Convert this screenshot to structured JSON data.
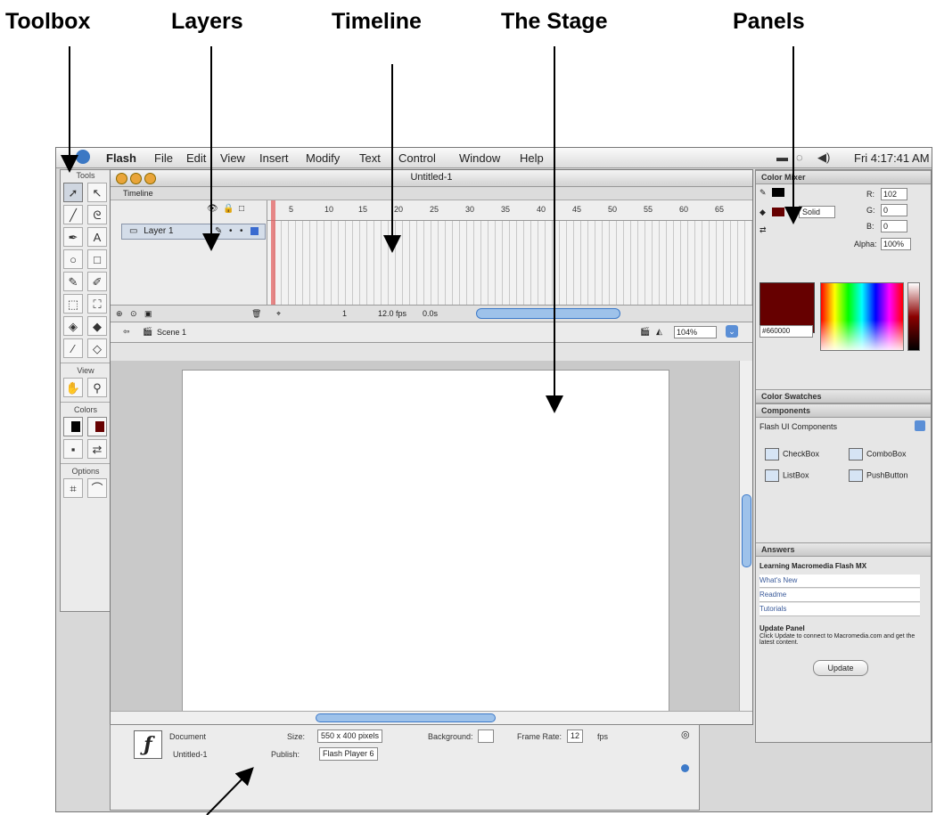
{
  "callouts": {
    "toolbox": "Toolbox",
    "layers": "Layers",
    "timeline": "Timeline",
    "stage": "The Stage",
    "panels": "Panels"
  },
  "menubar": {
    "app_name": "Flash",
    "items": [
      "File",
      "Edit",
      "View",
      "Insert",
      "Modify",
      "Text",
      "Control",
      "Window",
      "Help"
    ],
    "clock": "Fri 4:17:41 AM"
  },
  "toolbox": {
    "title": "Tools",
    "view_label": "View",
    "colors_label": "Colors",
    "options_label": "Options",
    "stroke_color": "#000000",
    "fill_color": "#660000"
  },
  "document": {
    "title": "Untitled-1",
    "timeline_label": "Timeline",
    "layer_name": "Layer 1",
    "frame_numbers": [
      "5",
      "10",
      "15",
      "20",
      "25",
      "30",
      "35",
      "40",
      "45",
      "50",
      "55",
      "60",
      "65"
    ],
    "status": {
      "frame": "1",
      "fps": "12.0 fps",
      "time": "0.0s"
    },
    "scene": "Scene 1",
    "zoom": "104%"
  },
  "properties": {
    "type": "Document",
    "name": "Untitled-1",
    "size_label": "Size:",
    "size_value": "550 x 400 pixels",
    "background_label": "Background:",
    "framerate_label": "Frame Rate:",
    "framerate_value": "12",
    "fps_unit": "fps",
    "publish_label": "Publish:",
    "publish_value": "Flash Player 6"
  },
  "panels": {
    "color_mixer": {
      "title": "Color Mixer",
      "r_label": "R:",
      "r": "102",
      "g_label": "G:",
      "g": "0",
      "b_label": "B:",
      "b": "0",
      "alpha_label": "Alpha:",
      "alpha": "100%",
      "fill_type": "Solid",
      "hex": "#660000",
      "swatch_color": "#660000"
    },
    "color_swatches": {
      "title": "Color Swatches"
    },
    "components": {
      "title": "Components",
      "set": "Flash UI Components",
      "items": [
        "CheckBox",
        "ComboBox",
        "ListBox",
        "PushButton"
      ]
    },
    "answers": {
      "title": "Answers",
      "heading": "Learning Macromedia Flash MX",
      "links": [
        "What's New",
        "Readme",
        "Tutorials"
      ],
      "update_title": "Update Panel",
      "update_text": "Click Update to connect to Macromedia.com and get the latest content.",
      "update_button": "Update"
    }
  }
}
